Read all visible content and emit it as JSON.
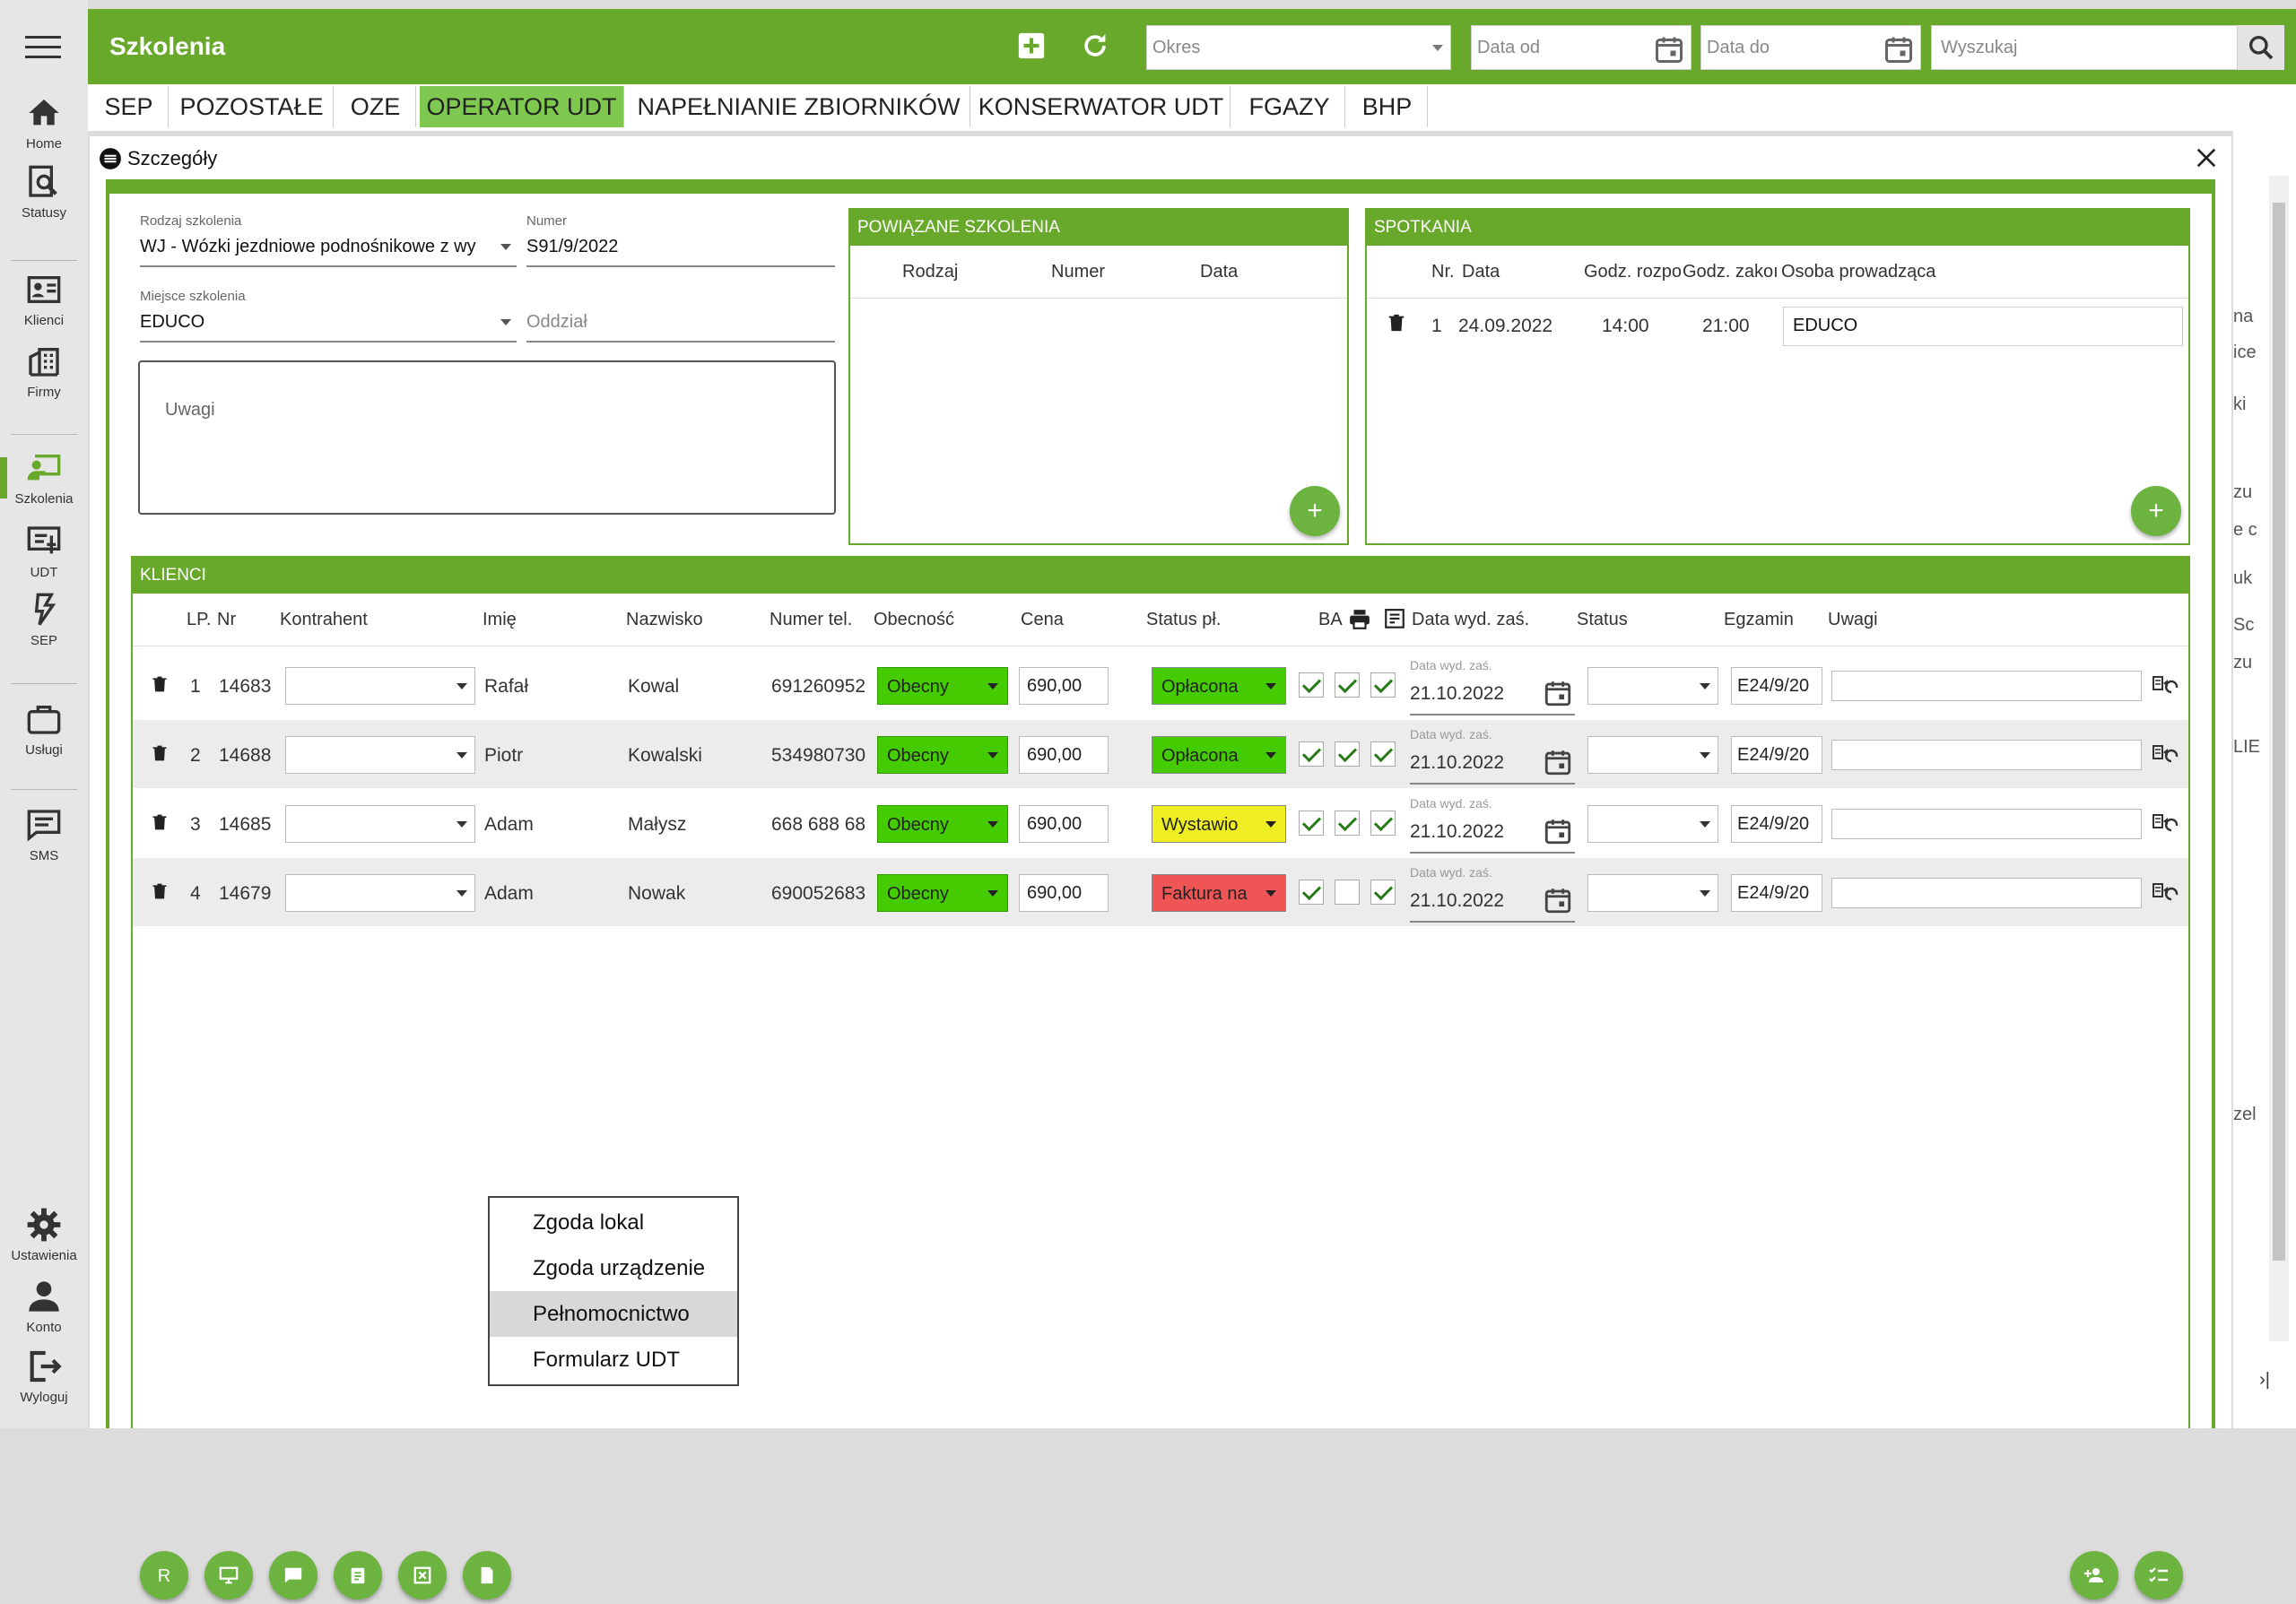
{
  "sidebar": {
    "items": [
      {
        "label": "Home",
        "icon": "home-icon"
      },
      {
        "label": "Statusy",
        "icon": "status-search-icon"
      },
      {
        "label": "Klienci",
        "icon": "contact-card-icon"
      },
      {
        "label": "Firmy",
        "icon": "building-icon"
      },
      {
        "label": "Szkolenia",
        "icon": "training-icon"
      },
      {
        "label": "UDT",
        "icon": "presentation-icon"
      },
      {
        "label": "SEP",
        "icon": "lightning-icon"
      },
      {
        "label": "Usługi",
        "icon": "briefcase-icon"
      },
      {
        "label": "SMS",
        "icon": "message-icon"
      },
      {
        "label": "Ustawienia",
        "icon": "gear-icon"
      },
      {
        "label": "Konto",
        "icon": "person-icon"
      },
      {
        "label": "Wyloguj",
        "icon": "logout-icon"
      }
    ]
  },
  "topbar": {
    "title": "Szkolenia",
    "period_placeholder": "Okres",
    "date_from_placeholder": "Data od",
    "date_to_placeholder": "Data do",
    "search_placeholder": "Wyszukaj"
  },
  "tabs": [
    "SEP",
    "POZOSTAŁE",
    "OZE",
    "OPERATOR UDT",
    "NAPEŁNIANIE ZBIORNIKÓW",
    "KONSERWATOR UDT",
    "FGAZY",
    "BHP"
  ],
  "active_tab": "OPERATOR UDT",
  "dialog": {
    "title": "Szczegóły",
    "form": {
      "type_label": "Rodzaj szkolenia",
      "type_value": "WJ  - Wózki jezdniowe podnośnikowe z wy",
      "number_label": "Numer",
      "number_value": "S91/9/2022",
      "place_label": "Miejsce szkolenia",
      "place_value": "EDUCO",
      "branch_placeholder": "Oddział",
      "notes_placeholder": "Uwagi"
    },
    "related": {
      "title": "POWIĄZANE SZKOLENIA",
      "columns": [
        "Rodzaj",
        "Numer",
        "Data"
      ]
    },
    "meetings": {
      "title": "SPOTKANIA",
      "columns": [
        "Nr.",
        "Data",
        "Godz. rozpo",
        "Godz. zakoı",
        "Osoba prowadząca"
      ],
      "rows": [
        {
          "nr": "1",
          "date": "24.09.2022",
          "start": "14:00",
          "end": "21:00",
          "person": "EDUCO"
        }
      ]
    },
    "clients": {
      "title": "KLIENCI",
      "columns": [
        "LP.",
        "Nr",
        "Kontrahent",
        "Imię",
        "Nazwisko",
        "Numer tel.",
        "Obecność",
        "Cena",
        "Status pł.",
        "BA",
        "Data wyd. zaś.",
        "Status",
        "Egzamin",
        "Uwagi"
      ],
      "date_field_label": "Data wyd. zaś.",
      "rows": [
        {
          "lp": "1",
          "nr": "14683",
          "first": "Rafał",
          "last": "Kowal",
          "phone": "691260952",
          "presence": "Obecny",
          "price": "690,00",
          "pay_status": "Opłacona",
          "pay_color": "#44cc00",
          "ba": true,
          "print": true,
          "doc": true,
          "date": "21.10.2022",
          "exam": "E24/9/20"
        },
        {
          "lp": "2",
          "nr": "14688",
          "first": "Piotr",
          "last": "Kowalski",
          "phone": "534980730",
          "presence": "Obecny",
          "price": "690,00",
          "pay_status": "Opłacona",
          "pay_color": "#44cc00",
          "ba": true,
          "print": true,
          "doc": true,
          "date": "21.10.2022",
          "exam": "E24/9/20"
        },
        {
          "lp": "3",
          "nr": "14685",
          "first": "Adam",
          "last": "Małysz",
          "phone": "668 688 68",
          "presence": "Obecny",
          "price": "690,00",
          "pay_status": "Wystawio",
          "pay_color": "#eeee22",
          "ba": true,
          "print": true,
          "doc": true,
          "date": "21.10.2022",
          "exam": "E24/9/20"
        },
        {
          "lp": "4",
          "nr": "14679",
          "first": "Adam",
          "last": "Nowak",
          "phone": "690052683",
          "presence": "Obecny",
          "price": "690,00",
          "pay_status": "Faktura na",
          "pay_color": "#f05555",
          "ba": true,
          "print": false,
          "doc": true,
          "date": "21.10.2022",
          "exam": "E24/9/20"
        }
      ]
    },
    "context_menu": {
      "items": [
        "Zgoda lokal",
        "Zgoda urządzenie",
        "Pełnomocnictwo",
        "Formularz UDT"
      ],
      "highlighted": "Pełnomocnictwo"
    },
    "bottom_buttons": {
      "r_label": "R"
    }
  },
  "background_fragments": [
    "na",
    "ice",
    "ki",
    "zu",
    "e c",
    "uk",
    "Sc",
    "zu",
    "LIE",
    "zel"
  ]
}
